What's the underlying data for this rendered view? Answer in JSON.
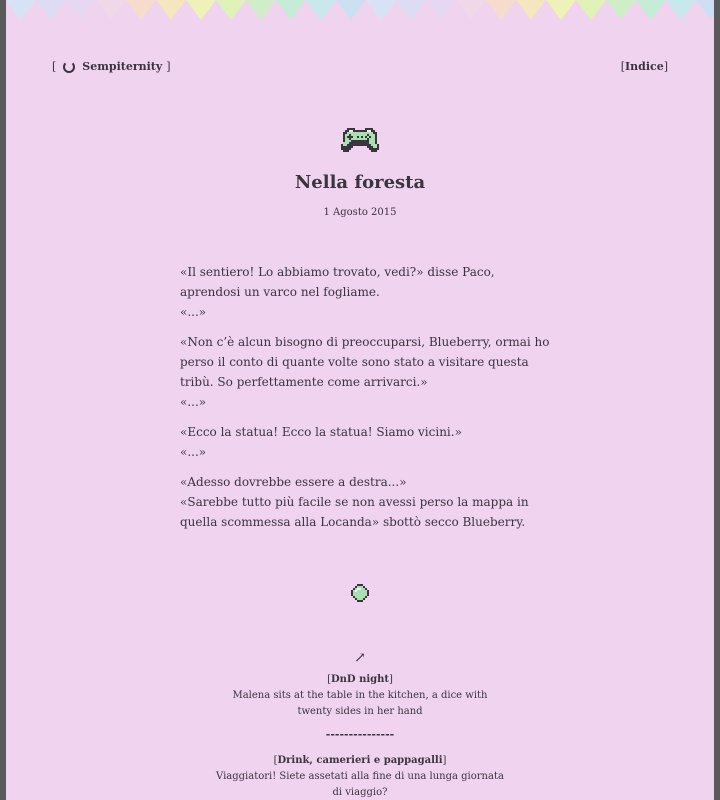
{
  "nav": {
    "brand_open": "[",
    "brand_name": "Sempiternity",
    "brand_close": "]",
    "index_label": "Indice"
  },
  "post": {
    "title": "Nella foresta",
    "date": "1 Agosto 2015",
    "paragraphs": [
      [
        "«Il sentiero! Lo abbiamo trovato, vedi?» disse Paco, aprendosi un varco nel fogliame.",
        "«...»"
      ],
      [
        "«Non c’è alcun bisogno di preoccuparsi, Blueberry, ormai ho perso il conto di quante volte sono stato a visitare questa tribù. So perfettamente come arrivarci.»",
        "«...»"
      ],
      [
        "«Ecco la statua! Ecco la statua! Siamo vicini.»",
        "«...»"
      ],
      [
        "«Adesso dovrebbe essere a destra...»",
        "«Sarebbe tutto più facile se non avessi perso la mappa in quella scommessa alla Locanda» sbottò secco Blueberry."
      ]
    ]
  },
  "related": {
    "arrow": "↗",
    "items": [
      {
        "title": "DnD night",
        "desc": "Malena sits at the table in the kitchen, a dice with twenty sides in her hand"
      },
      {
        "title": "Drink, camerieri e pappagalli",
        "desc": "Viaggiatori! Siete assetati alla fine di una lunga giornata di viaggio?"
      }
    ],
    "separator": "---------------"
  },
  "colors": {
    "background": "#efd3ef",
    "text": "#3a3340",
    "gamepad": "#a8e0b0",
    "bunting": [
      "#d6e3f5",
      "#dcdcf5",
      "#e6d8f3",
      "#f0d8e8",
      "#f5dccc",
      "#f5e6c0",
      "#eef2b8",
      "#dff2b8",
      "#cfeec8",
      "#c6ecd8",
      "#c8e8ee",
      "#cde0f3"
    ]
  },
  "icons": {
    "brand": "spinner-icon",
    "header": "gamepad-icon",
    "divider": "orb-icon",
    "related": "arrow-up-right-icon"
  }
}
